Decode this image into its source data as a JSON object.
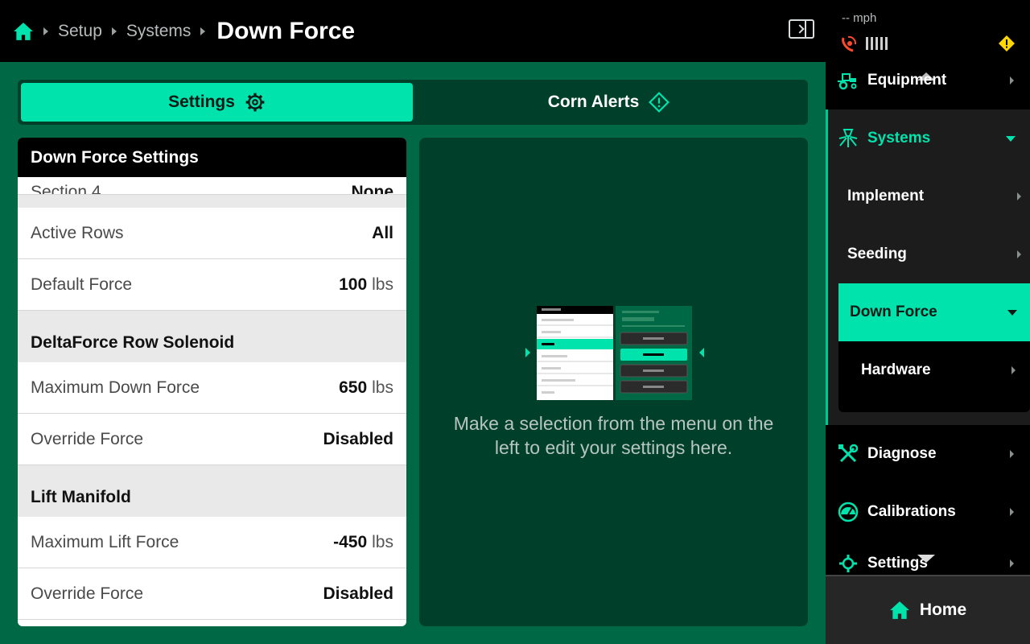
{
  "breadcrumb": {
    "items": [
      "Setup",
      "Systems"
    ],
    "current": "Down Force"
  },
  "tabs": [
    {
      "label": "Settings",
      "icon": "gear-icon",
      "active": true
    },
    {
      "label": "Corn Alerts",
      "icon": "diamond-alert-icon",
      "active": false
    }
  ],
  "card": {
    "title": "Down Force Settings",
    "partial_row": {
      "label": "Section 4",
      "value": "None"
    },
    "rows_a": [
      {
        "label": "Active Rows",
        "value": "All",
        "unit": ""
      },
      {
        "label": "Default Force",
        "value": "100",
        "unit": "lbs"
      }
    ],
    "section_b": "DeltaForce Row Solenoid",
    "rows_b": [
      {
        "label": "Maximum Down Force",
        "value": "650",
        "unit": "lbs"
      },
      {
        "label": "Override Force",
        "value": "Disabled",
        "unit": ""
      }
    ],
    "section_c": "Lift Manifold",
    "rows_c": [
      {
        "label": "Maximum Lift Force",
        "value": "-450",
        "unit": "lbs"
      },
      {
        "label": "Override Force",
        "value": "Disabled",
        "unit": ""
      }
    ]
  },
  "preview": {
    "message": "Make a selection from the menu on the left to edit your settings here."
  },
  "status": {
    "speed": "-- mph"
  },
  "sidebar": {
    "equipment": "Equipment",
    "systems": "Systems",
    "implement": "Implement",
    "seeding": "Seeding",
    "down_force": "Down Force",
    "hardware": "Hardware",
    "diagnose": "Diagnose",
    "calibrations": "Calibrations",
    "settings": "Settings",
    "home": "Home"
  },
  "colors": {
    "accent": "#00e3ad",
    "background": "#006845",
    "panel": "#00402b",
    "warning": "#ffd60a",
    "alert": "#ff4b2b"
  }
}
